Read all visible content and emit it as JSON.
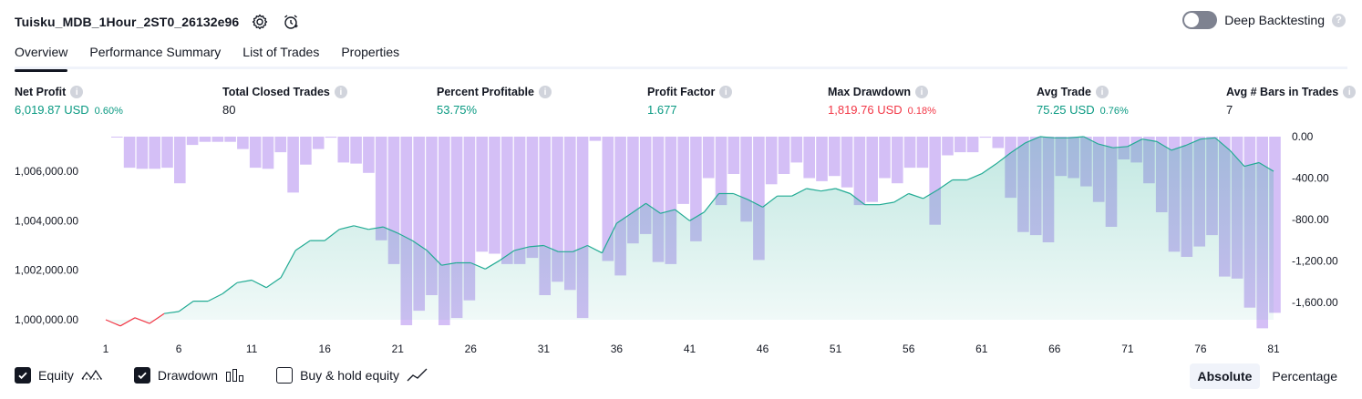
{
  "header": {
    "strategy_name": "Tuisku_MDB_1Hour_2ST0_26132e96",
    "settings_icon": "gear-icon",
    "alert_icon": "alarm-clock-icon"
  },
  "deep_backtesting": {
    "label": "Deep Backtesting",
    "enabled": false,
    "help": "?"
  },
  "tabs": [
    {
      "label": "Overview",
      "active": true
    },
    {
      "label": "Performance Summary",
      "active": false
    },
    {
      "label": "List of Trades",
      "active": false
    },
    {
      "label": "Properties",
      "active": false
    }
  ],
  "metrics": {
    "net_profit": {
      "label": "Net Profit",
      "value": "6,019.87 USD",
      "percent": "0.60%"
    },
    "total_closed_trades": {
      "label": "Total Closed Trades",
      "value": "80"
    },
    "percent_profitable": {
      "label": "Percent Profitable",
      "value": "53.75%"
    },
    "profit_factor": {
      "label": "Profit Factor",
      "value": "1.677"
    },
    "max_drawdown": {
      "label": "Max Drawdown",
      "value": "1,819.76 USD",
      "percent": "0.18%"
    },
    "avg_trade": {
      "label": "Avg Trade",
      "value": "75.25 USD",
      "percent": "0.76%"
    },
    "avg_bars": {
      "label": "Avg # Bars in Trades",
      "value": "7"
    }
  },
  "colors": {
    "positive": "#089981",
    "negative": "#f23645",
    "equity_line": "#22ab94",
    "drawdown_bar": "#cdb4f5"
  },
  "chart_data": {
    "type": "line",
    "x_ticks": [
      "1",
      "6",
      "11",
      "16",
      "21",
      "26",
      "31",
      "36",
      "41",
      "46",
      "51",
      "56",
      "61",
      "66",
      "71",
      "76",
      "81"
    ],
    "equity": {
      "name": "Equity",
      "axis": "left",
      "ylim": [
        999500,
        1007500
      ],
      "y_ticks": [
        "1,000,000.00",
        "1,002,000.00",
        "1,004,000.00",
        "1,006,000.00"
      ],
      "x": [
        1,
        2,
        3,
        4,
        5,
        6,
        7,
        8,
        9,
        10,
        11,
        12,
        13,
        14,
        15,
        16,
        17,
        18,
        19,
        20,
        21,
        22,
        23,
        24,
        25,
        26,
        27,
        28,
        29,
        30,
        31,
        32,
        33,
        34,
        35,
        36,
        37,
        38,
        39,
        40,
        41,
        42,
        43,
        44,
        45,
        46,
        47,
        48,
        49,
        50,
        51,
        52,
        53,
        54,
        55,
        56,
        57,
        58,
        59,
        60,
        61,
        62,
        63,
        64,
        65,
        66,
        67,
        68,
        69,
        70,
        71,
        72,
        73,
        74,
        75,
        76,
        77,
        78,
        79,
        80,
        81
      ],
      "values": [
        1000000,
        999750,
        1000080,
        999850,
        1000250,
        1000330,
        1000750,
        1000750,
        1001050,
        1001500,
        1001600,
        1001300,
        1001700,
        1002800,
        1003200,
        1003200,
        1003650,
        1003800,
        1003650,
        1003750,
        1003500,
        1003200,
        1002800,
        1002200,
        1002300,
        1002300,
        1002050,
        1002400,
        1002800,
        1002950,
        1003000,
        1002750,
        1002750,
        1003000,
        1002700,
        1003900,
        1004300,
        1004700,
        1004300,
        1004450,
        1004000,
        1004350,
        1005100,
        1005100,
        1004850,
        1004550,
        1005000,
        1005000,
        1005300,
        1005200,
        1005300,
        1005100,
        1004650,
        1004650,
        1004750,
        1005100,
        1004900,
        1005250,
        1005650,
        1005650,
        1005900,
        1006300,
        1006750,
        1007150,
        1007400,
        1007350,
        1007350,
        1007400,
        1007100,
        1006950,
        1007000,
        1007300,
        1007200,
        1006850,
        1007050,
        1007300,
        1007350,
        1006850,
        1006200,
        1006350,
        1006000,
        1006000
      ]
    },
    "drawdown": {
      "name": "Drawdown",
      "axis": "right",
      "ylim": [
        -1800,
        0
      ],
      "y_ticks": [
        "0.00",
        "-400.00",
        "-800.00",
        "-1,200.00",
        "-1,600.00"
      ],
      "values": [
        0,
        -300,
        -310,
        -310,
        -300,
        -450,
        -80,
        -50,
        -50,
        -50,
        -120,
        -300,
        -310,
        -150,
        -540,
        -270,
        -120,
        -10,
        -250,
        -260,
        -350,
        -1000,
        -1230,
        -1820,
        -1680,
        -1530,
        -1820,
        -1750,
        -1580,
        -1110,
        -1130,
        -1230,
        -1230,
        -1170,
        -1530,
        -1400,
        -1480,
        -1750,
        -40,
        -1200,
        -1340,
        -1030,
        -940,
        -1210,
        -1230,
        -650,
        -1010,
        -400,
        -660,
        -360,
        -820,
        -1190,
        -460,
        -360,
        -250,
        -400,
        -430,
        -380,
        -490,
        -660,
        -630,
        -400,
        -450,
        -300,
        -300,
        -850,
        -180,
        -150,
        -150,
        -10,
        -110,
        -590,
        -920,
        -950,
        -1020,
        -380,
        -400,
        -480,
        -630,
        -870,
        -220,
        -250,
        -450,
        -730,
        -1110,
        -1160,
        -1060,
        -950,
        -1350,
        -1370,
        -1650,
        -1850,
        -1700
      ],
      "note": ""
    }
  },
  "legend": [
    {
      "label": "Equity",
      "checked": true,
      "icon": "equity-line-icon"
    },
    {
      "label": "Drawdown",
      "checked": true,
      "icon": "drawdown-bars-icon"
    },
    {
      "label": "Buy & hold equity",
      "checked": false,
      "icon": "buy-hold-line-icon"
    }
  ],
  "view_mode": {
    "absolute": "Absolute",
    "percentage": "Percentage",
    "selected": "Absolute"
  }
}
